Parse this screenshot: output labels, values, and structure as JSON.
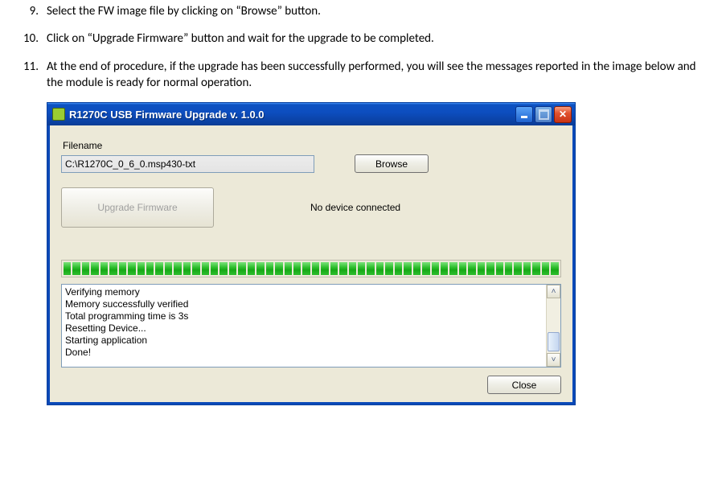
{
  "instructions": {
    "step9": "Select the FW image file by clicking on “Browse” button.",
    "step10": "Click on “Upgrade Firmware” button and wait for the upgrade to be completed.",
    "step11": "At the end of procedure, if the upgrade has been successfully performed, you will see the messages reported in the image below and the module is ready for normal operation."
  },
  "dialog": {
    "title": "R1270C USB Firmware Upgrade v. 1.0.0",
    "filename_label": "Filename",
    "filepath": "C:\\R1270C_0_6_0.msp430-txt",
    "browse_label": "Browse",
    "upgrade_label": "Upgrade Firmware",
    "status": "No device connected",
    "progress_percent": 100,
    "log_lines": [
      "Verifying memory",
      "Memory successfully verified",
      "Total programming time is 3s",
      "Resetting Device...",
      "Starting application",
      "Done!"
    ],
    "close_label": "Close"
  }
}
